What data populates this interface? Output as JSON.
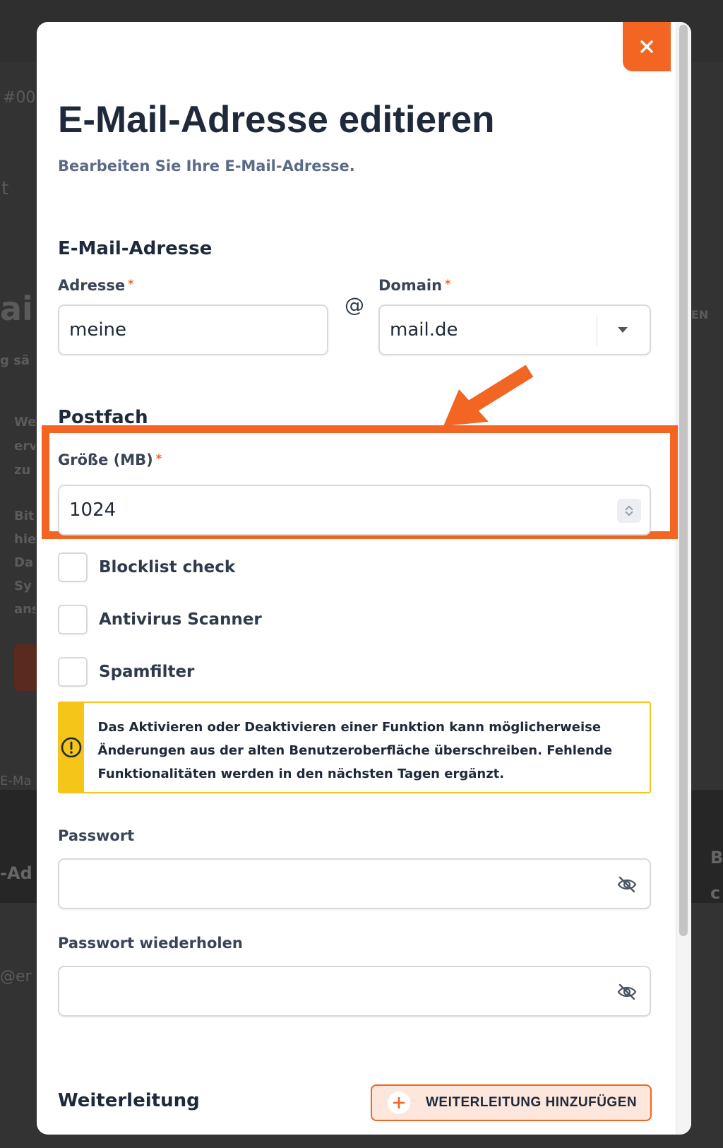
{
  "background": {
    "hash_fragment": "#00",
    "title_fragment": "ai",
    "t_fragment": "t",
    "text_fragment_1": "g sä",
    "lines": [
      "We",
      "erv",
      "zu",
      "Bit",
      "hie",
      "Da",
      "Sy",
      "ans"
    ],
    "email_fragment": "E-Ma",
    "dark_fragment": "-Ad",
    "right_fragment": "EN",
    "right_fragment2": "B",
    "right_fragment3": "c",
    "at_fragment": "@er"
  },
  "modal": {
    "close_label": "×",
    "title": "E-Mail-Adresse editieren",
    "subtitle": "Bearbeiten Sie Ihre E-Mail-Adresse.",
    "email_section": {
      "heading": "E-Mail-Adresse",
      "address_label": "Adresse",
      "address_value": "meine",
      "at": "@",
      "domain_label": "Domain",
      "domain_value": "mail.de",
      "required_mark": "*"
    },
    "mailbox_section": {
      "heading": "Postfach",
      "size_label": "Größe (MB)",
      "size_value": "1024",
      "checkboxes": [
        {
          "label": "Blocklist check"
        },
        {
          "label": "Antivirus Scanner"
        },
        {
          "label": "Spamfilter"
        }
      ]
    },
    "warning": {
      "text": "Das Aktivieren oder Deaktivieren einer Funktion kann möglicherweise Änderungen aus der alten Benutzeroberfläche überschreiben. Fehlende Funktionalitäten werden in den nächsten Tagen ergänzt."
    },
    "password": {
      "label": "Passwort",
      "repeat_label": "Passwort wiederholen"
    },
    "forwarding": {
      "heading": "Weiterleitung",
      "add_button": "WEITERLEITUNG HINZUFÜGEN"
    }
  },
  "colors": {
    "accent": "#f26522",
    "warning": "#f5c518",
    "heading": "#1e2a3b",
    "subtitle": "#5b6b86"
  }
}
